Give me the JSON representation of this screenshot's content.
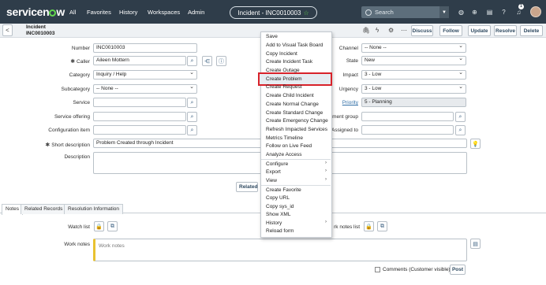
{
  "topnav": {
    "logo": "servicenow",
    "items": [
      "All",
      "Favorites",
      "History",
      "Workspaces",
      "Admin"
    ],
    "record_pill": "Incident - INC0010003",
    "search_placeholder": "Search",
    "notification_count": "1"
  },
  "formheader": {
    "back": "<",
    "title_line1": "Incident",
    "title_line2": "INC0010003",
    "buttons": [
      "Discuss",
      "Follow",
      "Update",
      "Resolve",
      "Delete"
    ]
  },
  "fields": {
    "number": {
      "label": "Number",
      "value": "INC0010003"
    },
    "caller": {
      "label": "Caller",
      "value": "Aileen Mottern"
    },
    "category": {
      "label": "Category",
      "value": "Inquiry / Help"
    },
    "subcategory": {
      "label": "Subcategory",
      "value": "-- None --"
    },
    "service": {
      "label": "Service",
      "value": ""
    },
    "service_offering": {
      "label": "Service offering",
      "value": ""
    },
    "configuration_item": {
      "label": "Configuration item",
      "value": ""
    },
    "short_description": {
      "label": "Short description",
      "value": "Problem Created through Incident"
    },
    "description": {
      "label": "Description",
      "value": ""
    },
    "channel": {
      "label": "Channel",
      "value": "-- None --"
    },
    "state": {
      "label": "State",
      "value": "New"
    },
    "impact": {
      "label": "Impact",
      "value": "3 - Low"
    },
    "urgency": {
      "label": "Urgency",
      "value": "3 - Low"
    },
    "priority": {
      "label": "Priority",
      "value": "5 - Planning"
    },
    "assignment_group": {
      "label": "ment group",
      "value": ""
    },
    "assigned_to": {
      "label": "Assigned to",
      "value": ""
    }
  },
  "related_button": "Related",
  "tabs": [
    "Notes",
    "Related Records",
    "Resolution Information"
  ],
  "notes": {
    "watch_list_label": "Watch list",
    "work_notes_list_label": "rk notes list",
    "work_notes_label": "Work notes",
    "work_notes_placeholder": "Work notes",
    "comments_checkbox_label": "Comments (Customer visible)",
    "post_button": "Post"
  },
  "context_menu": {
    "group1": [
      "Save",
      "Add to Visual Task Board",
      "Copy Incident",
      "Create Incident Task",
      "Create Outage",
      "Create Problem",
      "Create Request",
      "Create Child Incident",
      "Create Normal Change",
      "Create Standard Change",
      "Create Emergency Change",
      "Refresh Impacted Services",
      "Metrics Timeline",
      "Follow on Live Feed",
      "Analyze Access"
    ],
    "group2": [
      "Configure",
      "Export",
      "View"
    ],
    "group3": [
      "Create Favorite",
      "Copy URL",
      "Copy sys_id",
      "Show XML",
      "History",
      "Reload form"
    ],
    "highlighted": "Create Problem"
  }
}
